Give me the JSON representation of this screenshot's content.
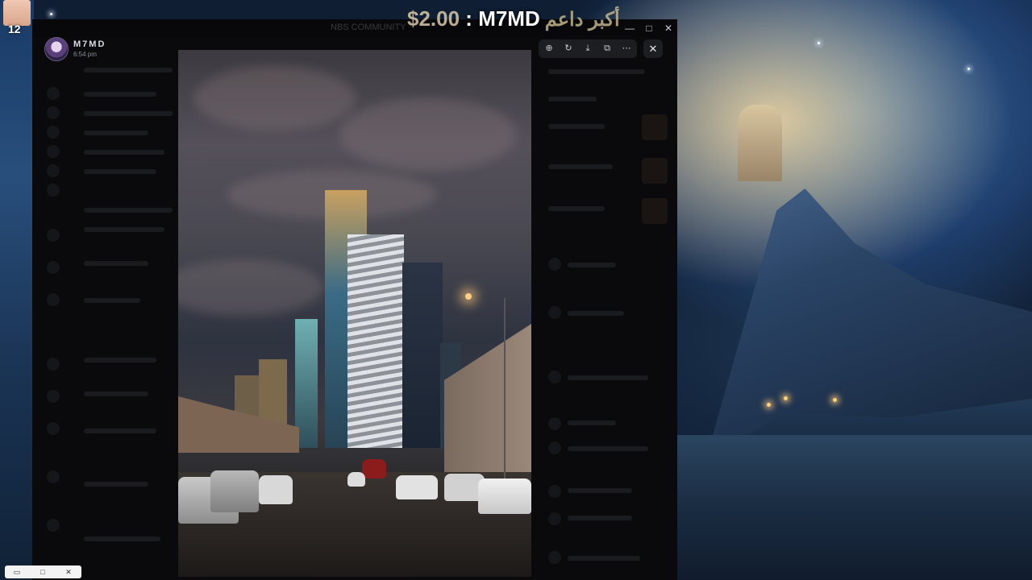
{
  "desktop": {
    "corner_label": "12"
  },
  "window": {
    "title": "NBS COMMUNITY"
  },
  "uploader": {
    "name": "M7MD",
    "time": "6:54 pm"
  },
  "overlay_title": {
    "price": "$2.00",
    "separator": " : ",
    "name": "M7MD",
    "arabic": "أكبر داعم"
  },
  "viewer_toolbar": {
    "zoom_icon": "⊕",
    "rotate_icon": "↻",
    "download_icon": "⤓",
    "open_icon": "⧉",
    "more_icon": "⋯",
    "close_icon": "✕"
  },
  "window_controls": {
    "minimize": "—",
    "maximize": "□",
    "close": "✕"
  },
  "taskbar_snippet": {
    "restore": "▭",
    "maximize": "□",
    "close": "✕"
  }
}
